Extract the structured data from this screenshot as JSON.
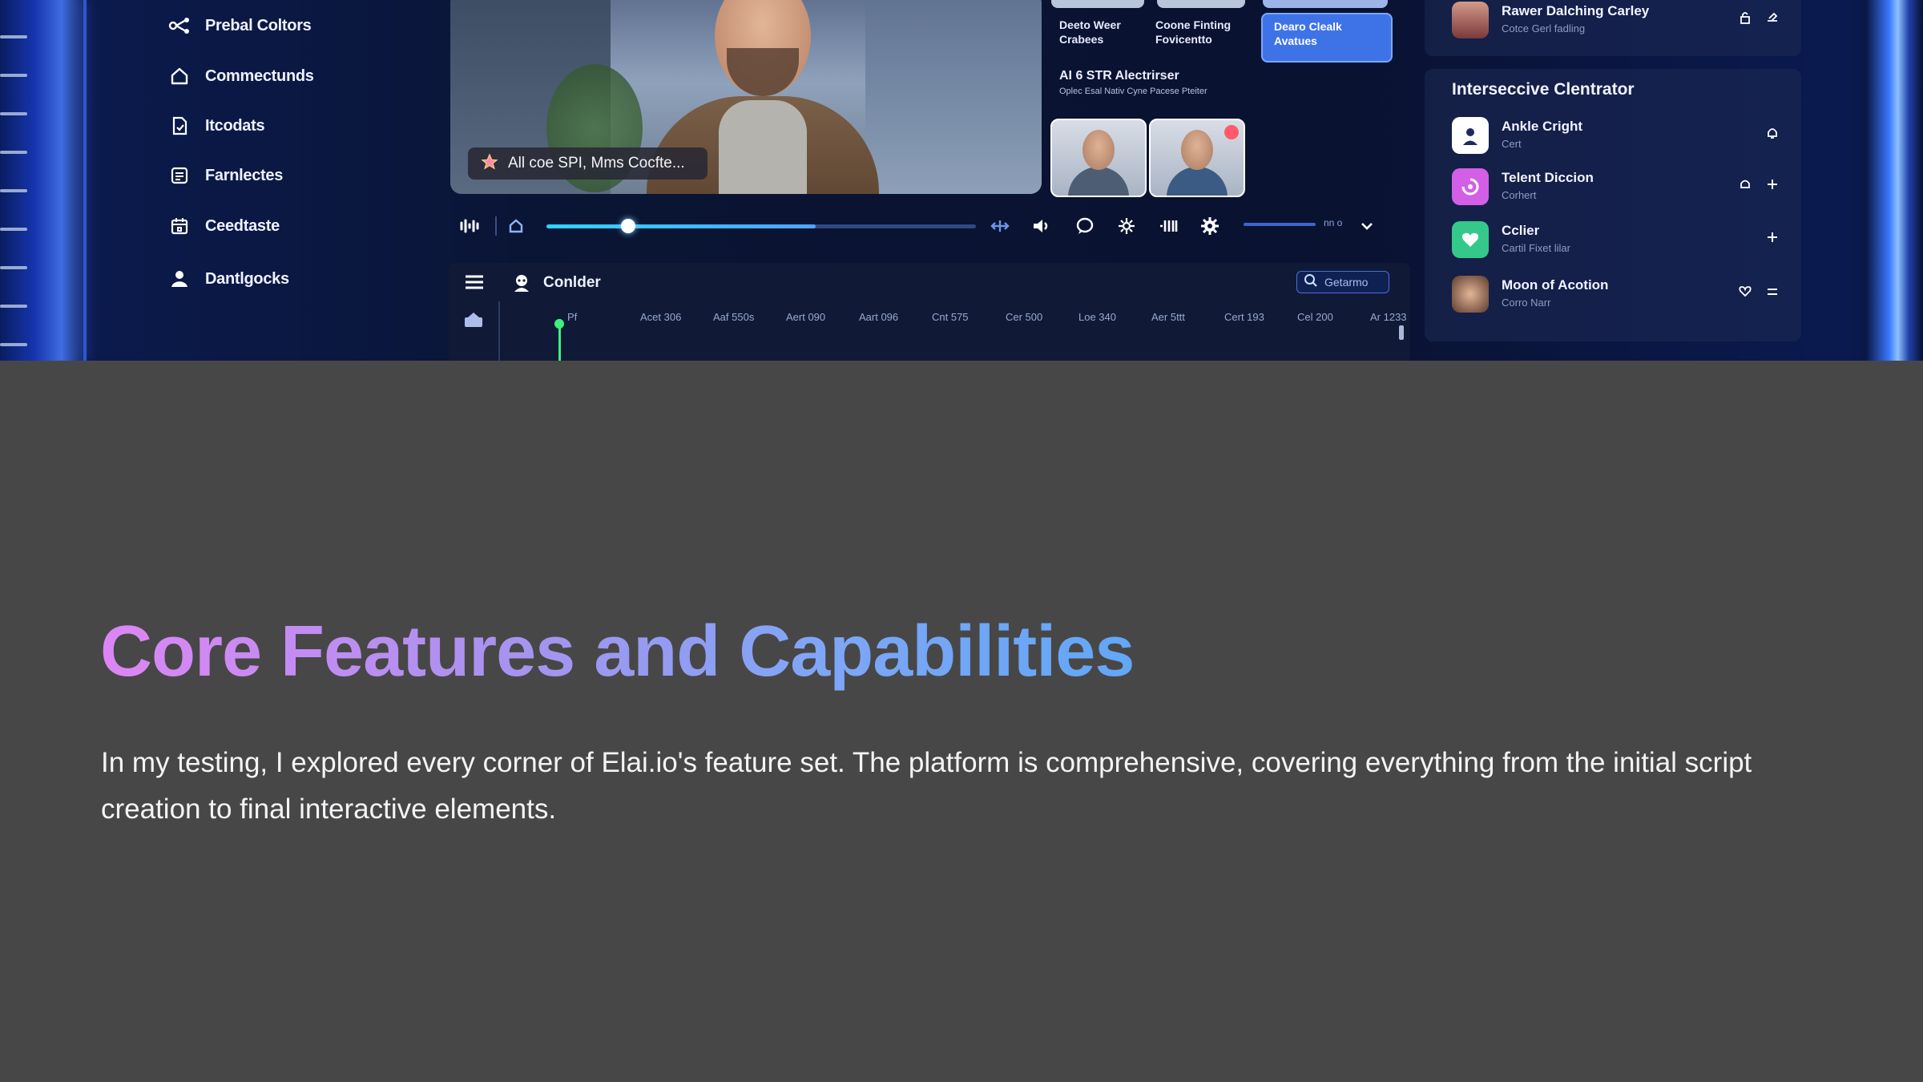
{
  "sidebar": {
    "items": [
      {
        "label": "Prebal Coltors",
        "icon": "connections-icon"
      },
      {
        "label": "Commectunds",
        "icon": "home-icon"
      },
      {
        "label": "Itcodats",
        "icon": "document-icon"
      },
      {
        "label": "Farnlectes",
        "icon": "grid-icon"
      },
      {
        "label": "Ceedtaste",
        "icon": "calendar-icon"
      },
      {
        "label": "Dantlgocks",
        "icon": "user-icon"
      }
    ]
  },
  "video": {
    "caption": "All coe SPI, Mms Cocfte..."
  },
  "avatar_cards": [
    {
      "label": "Deeto Weer Crabees"
    },
    {
      "label": "Coone Finting Fovicentto"
    },
    {
      "label": "Dearo Clealk Avatues",
      "selected": true
    }
  ],
  "algo": {
    "title": "AI 6 STR Alectrirser",
    "subtitle": "Oplec Esal Nativ Cyne Pacese Pteiter"
  },
  "controls": {
    "progress": 0.19,
    "volume_label": "nn o"
  },
  "timeline": {
    "title": "Conlder",
    "search_placeholder": "Getarmo",
    "ticks": [
      "Pf",
      "Acet 306",
      "Aaf 550s",
      "Aert 090",
      "Aart 096",
      "Cnt 575",
      "Cer 500",
      "Loe 340",
      "Aer 5ttt",
      "Cert 193",
      "Cel 200",
      "Ar 1233"
    ]
  },
  "right_panel": {
    "top_item": {
      "name": "Rawer Dalching Carley",
      "sub": "Cotce Gerl fadling"
    },
    "title": "Interseccive Clentrator",
    "items": [
      {
        "name": "Ankle Cright",
        "sub": "Cert",
        "color": "#ffffff"
      },
      {
        "name": "Telent Diccion",
        "sub": "Corhert",
        "color": "#d25fe6"
      },
      {
        "name": "Cclier",
        "sub": "Cartil Fixet lilar",
        "color": "#34c98a"
      },
      {
        "name": "Moon of Acotion",
        "sub": "Corro Narr",
        "color": "#c9a08a"
      }
    ]
  },
  "article": {
    "heading": "Core Features and Capabilities",
    "paragraph": "In my testing, I explored every corner of Elai.io's feature set. The platform is comprehensive, covering everything from the initial script creation to final interactive elements."
  }
}
